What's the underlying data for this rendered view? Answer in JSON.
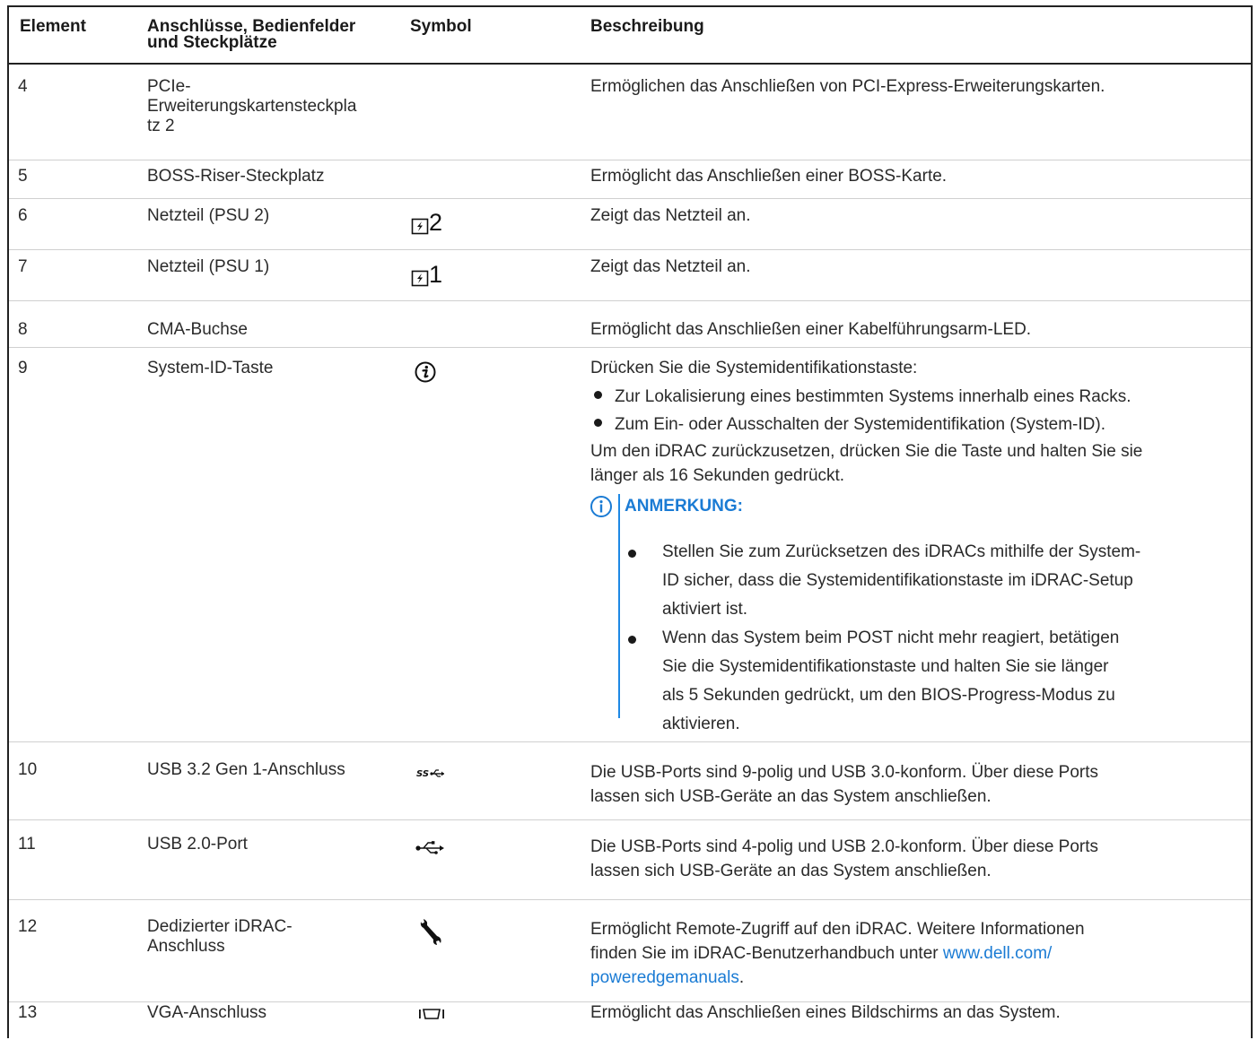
{
  "header": {
    "col_element": "Element",
    "col_ports_line1": "Anschlüsse, Bedienfelder",
    "col_ports_line2": "und Steckplätze",
    "col_symbol": "Symbol",
    "col_description": "Beschreibung"
  },
  "rows": [
    {
      "num": "4",
      "name_lines": [
        "PCIe-",
        "Erweiterungskartensteckpla",
        "tz 2"
      ],
      "desc": "Ermöglichen das Anschließen von PCI-Express-Erweiterungskarten."
    },
    {
      "num": "5",
      "name": "BOSS-Riser-Steckplatz",
      "desc": "Ermöglicht das Anschließen einer BOSS-Karte."
    },
    {
      "num": "6",
      "name": "Netzteil (PSU 2)",
      "symbol_icon": "psu-icon",
      "symbol_text": "2",
      "desc": "Zeigt das Netzteil an."
    },
    {
      "num": "7",
      "name": "Netzteil (PSU 1)",
      "symbol_icon": "psu-icon",
      "symbol_text": "1",
      "desc": "Zeigt das Netzteil an."
    },
    {
      "num": "8",
      "name": "CMA-Buchse",
      "desc": "Ermöglicht das Anschließen einer Kabelführungsarm-LED."
    },
    {
      "num": "9",
      "name": "System-ID-Taste",
      "symbol_icon": "system-id-icon",
      "desc_intro": "Drücken Sie die Systemidentifikationstaste:",
      "bullets": [
        "Zur Lokalisierung eines bestimmten Systems innerhalb eines Racks.",
        "Zum Ein- oder Ausschalten der Systemidentifikation (System-ID)."
      ],
      "desc_reset_line1": "Um den iDRAC zurückzusetzen, drücken Sie die Taste und halten Sie sie",
      "desc_reset_line2": "länger als 16 Sekunden gedrückt.",
      "note": {
        "icon": "info-icon",
        "title": "ANMERKUNG:",
        "bullet1_lines": [
          "Stellen Sie zum Zurücksetzen des iDRACs mithilfe der System-",
          "ID sicher, dass die Systemidentifikationstaste im iDRAC-Setup",
          "aktiviert ist."
        ],
        "bullet2_lines": [
          "Wenn das System beim POST nicht mehr reagiert, betätigen",
          "Sie die Systemidentifikationstaste und halten Sie sie länger",
          "als 5 Sekunden gedrückt, um den BIOS-Progress-Modus zu",
          "aktivieren."
        ]
      }
    },
    {
      "num": "10",
      "name": "USB 3.2 Gen 1-Anschluss",
      "symbol_icon": "usb-superspeed-icon",
      "desc_lines": [
        "Die USB-Ports sind 9-polig und USB 3.0-konform. Über diese Ports",
        "lassen sich USB-Geräte an das System anschließen."
      ]
    },
    {
      "num": "11",
      "name": "USB 2.0-Port",
      "symbol_icon": "usb-icon",
      "desc_lines": [
        "Die USB-Ports sind 4-polig und USB 2.0-konform. Über diese Ports",
        "lassen sich USB-Geräte an das System anschließen."
      ]
    },
    {
      "num": "12",
      "name_lines": [
        "Dedizierter iDRAC-",
        "Anschluss"
      ],
      "symbol_icon": "wrench-icon",
      "desc_line1": "Ermöglicht Remote-Zugriff auf den iDRAC. Weitere Informationen",
      "desc_line2_pre": "finden Sie im iDRAC-Benutzerhandbuch unter ",
      "link_part1": "www.dell.com/",
      "link_part2": "poweredgemanuals",
      "desc_end": "."
    },
    {
      "num": "13",
      "name": "VGA-Anschluss",
      "symbol_icon": "vga-icon",
      "desc": "Ermöglicht das Anschließen eines Bildschirms an das System."
    }
  ],
  "colors": {
    "note_accent": "#1a7bd4",
    "link": "#1a7bd4"
  }
}
